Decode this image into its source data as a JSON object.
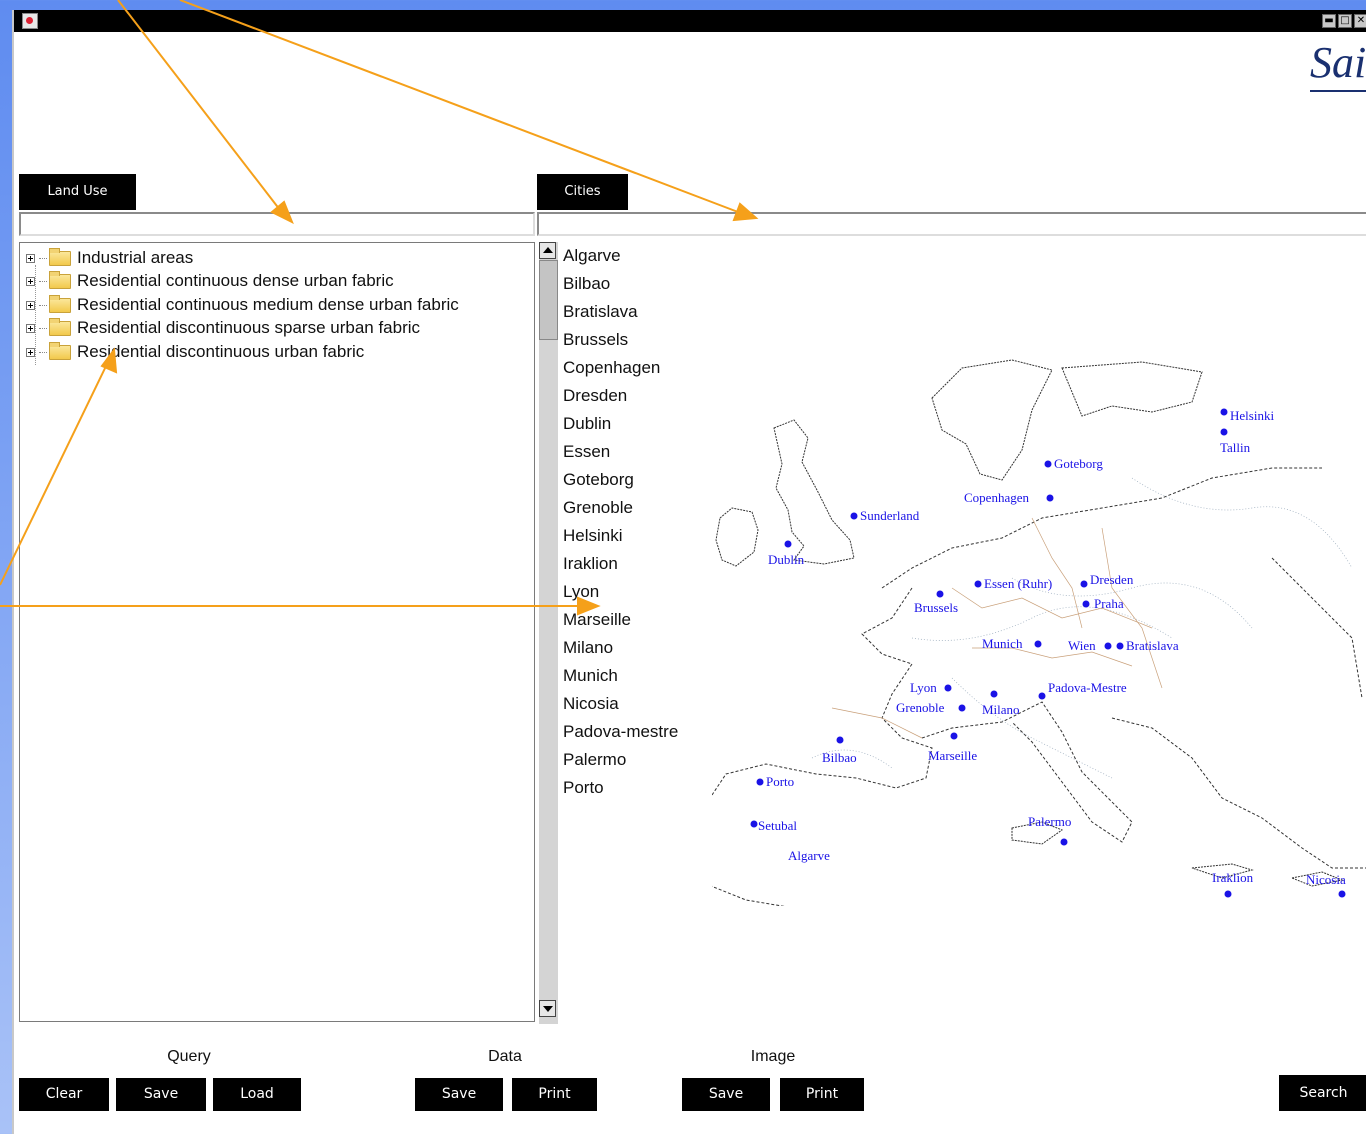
{
  "window": {
    "controls": [
      "▬",
      "□",
      "✕"
    ],
    "logo_text": "Sai"
  },
  "land_use": {
    "tab_label": "Land Use",
    "filter_value": "",
    "items": [
      "Industrial areas",
      "Residential continuous dense urban fabric",
      "Residential continuous medium dense urban fabric",
      "Residential discontinuous sparse urban fabric",
      "Residential discontinuous urban fabric"
    ]
  },
  "cities": {
    "tab_label": "Cities",
    "filter_value": "",
    "items": [
      "Algarve",
      "Bilbao",
      "Bratislava",
      "Brussels",
      "Copenhagen",
      "Dresden",
      "Dublin",
      "Essen",
      "Goteborg",
      "Grenoble",
      "Helsinki",
      "Iraklion",
      "Lyon",
      "Marseille",
      "Milano",
      "Munich",
      "Nicosia",
      "Padova-mestre",
      "Palermo",
      "Porto"
    ]
  },
  "map": {
    "marker_color": "#1a12e6",
    "labels": [
      "Helsinki",
      "Tallin",
      "Goteborg",
      "Copenhagen",
      "Sunderland",
      "Dublin",
      "Essen (Ruhr)",
      "Dresden",
      "Brussels",
      "Praha",
      "Munich",
      "Wien",
      "Bratislava",
      "Lyon",
      "Grenoble",
      "Milano",
      "Padova-Mestre",
      "Bilbao",
      "Marseille",
      "Porto",
      "Setubal",
      "Algarve",
      "Palermo",
      "Iraklion",
      "Nicosia"
    ]
  },
  "query": {
    "label": "Query",
    "clear": "Clear",
    "save": "Save",
    "load": "Load"
  },
  "data_group": {
    "label": "Data",
    "save": "Save",
    "print": "Print"
  },
  "image_group": {
    "label": "Image",
    "save": "Save",
    "print": "Print"
  },
  "search_label": "Search",
  "colors": {
    "annotation_arrow": "#f5a01a",
    "tab_background": "#000000",
    "background": "#6b93f2"
  }
}
